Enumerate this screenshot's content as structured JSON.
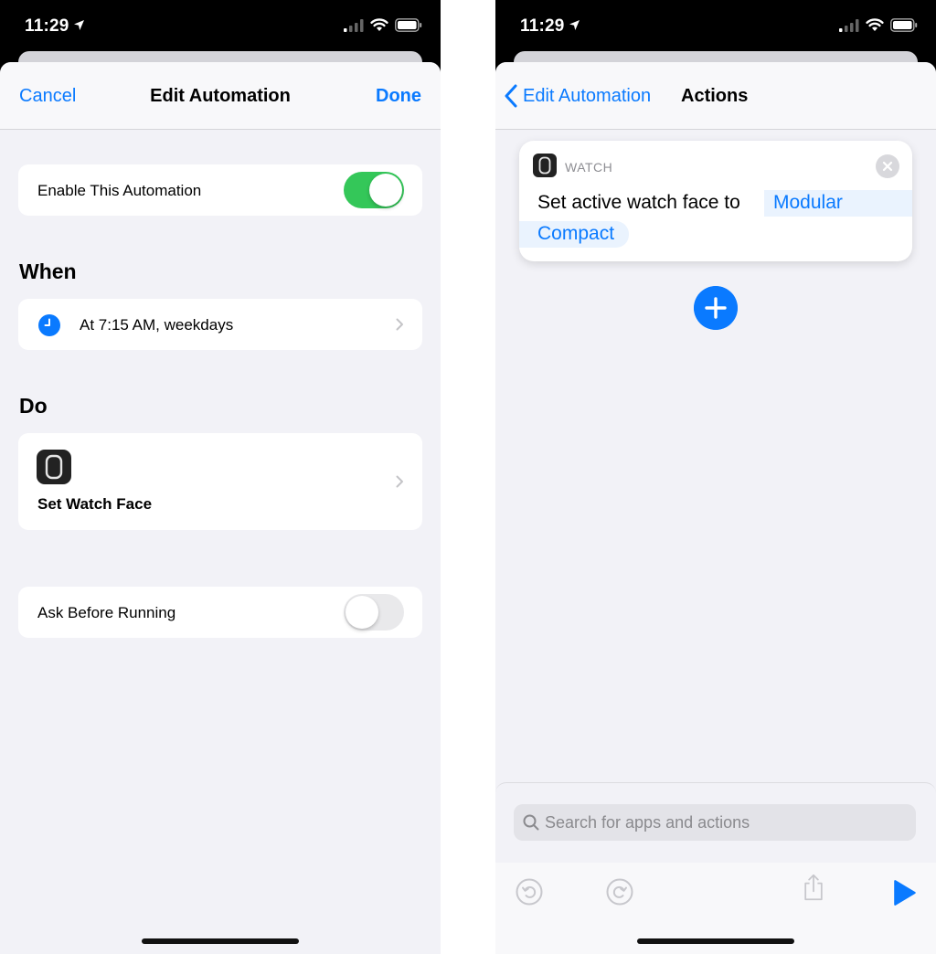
{
  "left_screen": {
    "status": {
      "time": "11:29"
    },
    "nav": {
      "cancel": "Cancel",
      "title": "Edit Automation",
      "done": "Done"
    },
    "enable_row": {
      "label": "Enable This Automation",
      "toggle_on": true
    },
    "when_section": {
      "header": "When",
      "trigger": "At 7:15 AM, weekdays"
    },
    "do_section": {
      "header": "Do",
      "action": "Set Watch Face"
    },
    "ask_row": {
      "label": "Ask Before Running",
      "toggle_on": false
    }
  },
  "right_screen": {
    "status": {
      "time": "11:29"
    },
    "nav": {
      "back_label": "Edit Automation",
      "title": "Actions"
    },
    "action_card": {
      "app_label": "WATCH",
      "text": "Set active watch face to",
      "parameter_part1": "Modular",
      "parameter_part2": "Compact"
    },
    "search": {
      "placeholder": "Search for apps and actions"
    },
    "toolbar_icons": [
      "undo-icon",
      "redo-icon",
      "share-icon",
      "play-icon"
    ]
  },
  "colors": {
    "accent": "#0a7aff",
    "toggle_on": "#34c759",
    "background": "#f2f2f7"
  }
}
